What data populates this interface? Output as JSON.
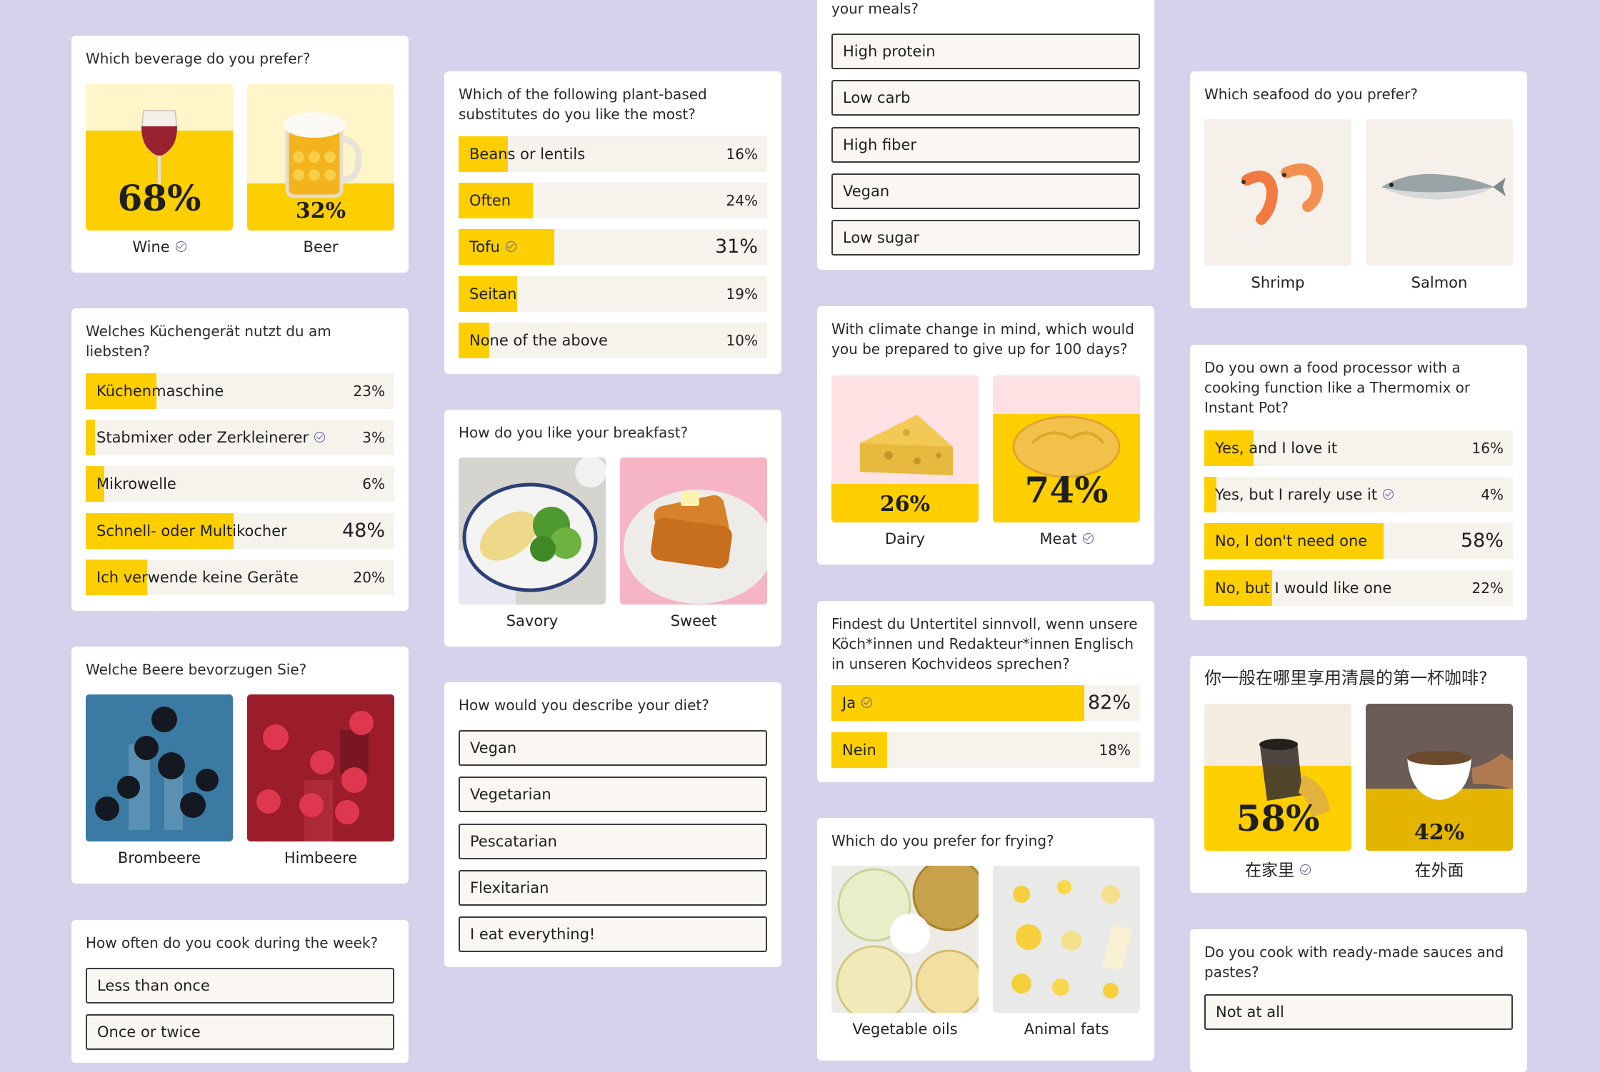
{
  "colors": {
    "background": "#d5d3eb",
    "accent_yellow": "#fdcf00",
    "bar_bg": "#f6f2ec",
    "check": "#5a58a8"
  },
  "beverage": {
    "question": "Which beverage do you prefer?",
    "options": [
      {
        "label": "Wine",
        "percent": "68%",
        "share": 0.68,
        "selected": true
      },
      {
        "label": "Beer",
        "percent": "32%",
        "share": 0.32,
        "selected": false
      }
    ]
  },
  "kitchen": {
    "question": "Welches Küchengerät nutzt du am liebsten?",
    "options": [
      {
        "label": "Küchenmaschine",
        "percent": "23%",
        "share": 0.23,
        "selected": false
      },
      {
        "label": "Stabmixer oder Zerkleinerer",
        "percent": "3%",
        "share": 0.03,
        "selected": true
      },
      {
        "label": "Mikrowelle",
        "percent": "6%",
        "share": 0.06,
        "selected": false
      },
      {
        "label": "Schnell- oder Multikocher",
        "percent": "48%",
        "share": 0.48,
        "selected": false
      },
      {
        "label": "Ich verwende keine Geräte",
        "percent": "20%",
        "share": 0.2,
        "selected": false
      }
    ]
  },
  "berry": {
    "question": "Welche Beere bevorzugen Sie?",
    "options": [
      {
        "label": "Brombeere"
      },
      {
        "label": "Himbeere"
      }
    ]
  },
  "cook_often": {
    "question": "How often do you cook during the week?",
    "options": [
      "Less than once",
      "Once or twice"
    ]
  },
  "plant": {
    "question": "Which of the following plant-based substitutes do you like the most?",
    "options": [
      {
        "label": "Beans or lentils",
        "percent": "16%",
        "share": 0.16,
        "selected": false
      },
      {
        "label": "Often",
        "percent": "24%",
        "share": 0.24,
        "selected": false
      },
      {
        "label": "Tofu",
        "percent": "31%",
        "share": 0.31,
        "selected": true
      },
      {
        "label": "Seitan",
        "percent": "19%",
        "share": 0.19,
        "selected": false
      },
      {
        "label": "None of the above",
        "percent": "10%",
        "share": 0.1,
        "selected": false
      }
    ]
  },
  "breakfast": {
    "question": "How do you like your breakfast?",
    "options": [
      {
        "label": "Savory"
      },
      {
        "label": "Sweet"
      }
    ]
  },
  "diet": {
    "question": "How would you describe your diet?",
    "options": [
      "Vegan",
      "Vegetarian",
      "Pescatarian",
      "Flexitarian",
      "I eat everything!"
    ]
  },
  "meals": {
    "question_tail": "your meals?",
    "options": [
      "High protein",
      "Low carb",
      "High fiber",
      "Vegan",
      "Low sugar"
    ]
  },
  "climate": {
    "question": "With climate change in mind, which would you be prepared to give up for 100 days?",
    "options": [
      {
        "label": "Dairy",
        "percent": "26%",
        "share": 0.26,
        "selected": false
      },
      {
        "label": "Meat",
        "percent": "74%",
        "share": 0.74,
        "selected": true
      }
    ]
  },
  "subtitles": {
    "question": "Findest du Untertitel sinnvoll, wenn unsere Köch*innen und Redakteur*innen Englisch in unseren Kochvideos sprechen?",
    "options": [
      {
        "label": "Ja",
        "percent": "82%",
        "share": 0.82,
        "selected": true
      },
      {
        "label": "Nein",
        "percent": "18%",
        "share": 0.18,
        "selected": false
      }
    ]
  },
  "frying": {
    "question": "Which do you prefer for frying?",
    "options": [
      {
        "label": "Vegetable oils"
      },
      {
        "label": "Animal fats"
      }
    ]
  },
  "seafood": {
    "question": "Which seafood do you prefer?",
    "options": [
      {
        "label": "Shrimp"
      },
      {
        "label": "Salmon"
      }
    ]
  },
  "processor": {
    "question": "Do you own a food processor with a cooking function like a Thermomix or Instant Pot?",
    "options": [
      {
        "label": "Yes, and I love it",
        "percent": "16%",
        "share": 0.16,
        "selected": false
      },
      {
        "label": "Yes, but I rarely use it",
        "percent": "4%",
        "share": 0.04,
        "selected": true
      },
      {
        "label": "No, I don't need one",
        "percent": "58%",
        "share": 0.58,
        "selected": false
      },
      {
        "label": "No, but I would like one",
        "percent": "22%",
        "share": 0.22,
        "selected": false
      }
    ]
  },
  "coffee": {
    "question": "你一般在哪里享用清晨的第一杯咖啡?",
    "options": [
      {
        "label": "在家里",
        "percent": "58%",
        "share": 0.58,
        "selected": true
      },
      {
        "label": "在外面",
        "percent": "42%",
        "share": 0.42,
        "selected": false
      }
    ]
  },
  "sauces": {
    "question": "Do you cook with ready-made sauces and pastes?",
    "options": [
      "Not at all"
    ]
  }
}
